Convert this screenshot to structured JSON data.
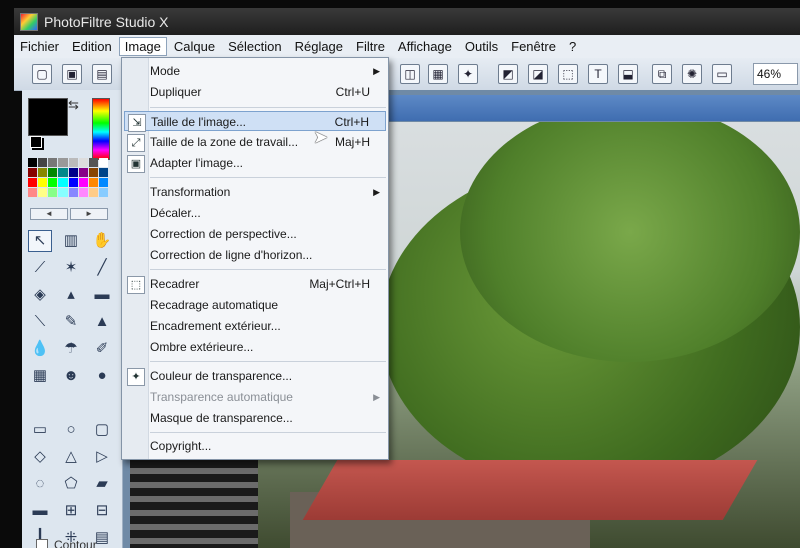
{
  "window": {
    "title": "PhotoFiltre Studio X"
  },
  "menubar": [
    "Fichier",
    "Edition",
    "Image",
    "Calque",
    "Sélection",
    "Réglage",
    "Filtre",
    "Affichage",
    "Outils",
    "Fenêtre",
    "?"
  ],
  "toolbar": {
    "zoom": "46%"
  },
  "image_menu": {
    "items": [
      {
        "label": "Mode",
        "shortcut": "",
        "submenu": true
      },
      {
        "label": "Dupliquer",
        "shortcut": "Ctrl+U"
      },
      {
        "label": "Taille de l'image...",
        "shortcut": "Ctrl+H",
        "icon": "resize-icon",
        "highlighted": true
      },
      {
        "label": "Taille de la zone de travail...",
        "shortcut": "Maj+H",
        "icon": "canvas-size-icon"
      },
      {
        "label": "Adapter l'image...",
        "shortcut": "",
        "icon": "fit-image-icon"
      },
      {
        "label": "Transformation",
        "shortcut": "",
        "submenu": true
      },
      {
        "label": "Décaler...",
        "shortcut": ""
      },
      {
        "label": "Correction de perspective...",
        "shortcut": ""
      },
      {
        "label": "Correction de ligne d'horizon...",
        "shortcut": ""
      },
      {
        "label": "Recadrer",
        "shortcut": "Maj+Ctrl+H",
        "icon": "crop-icon"
      },
      {
        "label": "Recadrage automatique",
        "shortcut": ""
      },
      {
        "label": "Encadrement extérieur...",
        "shortcut": ""
      },
      {
        "label": "Ombre extérieure...",
        "shortcut": ""
      },
      {
        "label": "Couleur de transparence...",
        "shortcut": "",
        "icon": "transparency-color-icon"
      },
      {
        "label": "Transparence automatique",
        "shortcut": "",
        "submenu": true,
        "disabled": true
      },
      {
        "label": "Masque de transparence...",
        "shortcut": ""
      },
      {
        "label": "Copyright...",
        "shortcut": ""
      }
    ]
  },
  "tool_panel": {
    "contour_label": "Contour"
  },
  "colors": {
    "accent": "#3f6db0",
    "highlight": "#cfe0f5",
    "foreground": "#000000"
  }
}
